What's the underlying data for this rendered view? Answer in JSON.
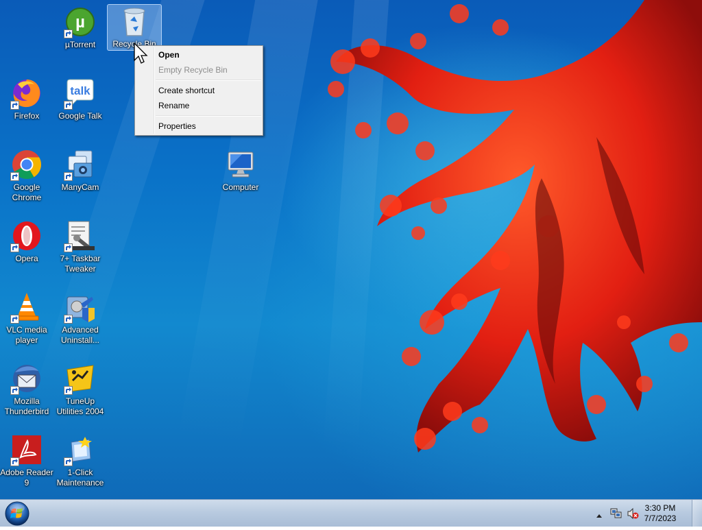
{
  "desktop_icons": [
    {
      "label": "µTorrent",
      "icon": "utorrent-icon"
    },
    {
      "label": "Recycle Bin",
      "icon": "recycle-bin-icon"
    },
    {
      "label": "Firefox",
      "icon": "firefox-icon"
    },
    {
      "label": "Google Talk",
      "icon": "google-talk-icon"
    },
    {
      "label": "Google\nChrome",
      "icon": "chrome-icon"
    },
    {
      "label": "ManyCam",
      "icon": "manycam-icon"
    },
    {
      "label": "Computer",
      "icon": "computer-icon"
    },
    {
      "label": "Opera",
      "icon": "opera-icon"
    },
    {
      "label": "7+ Taskbar\nTweaker",
      "icon": "taskbar-tweaker-icon"
    },
    {
      "label": "VLC media\nplayer",
      "icon": "vlc-icon"
    },
    {
      "label": "Advanced\nUninstall...",
      "icon": "advanced-uninstaller-icon"
    },
    {
      "label": "Mozilla\nThunderbird",
      "icon": "thunderbird-icon"
    },
    {
      "label": "TuneUp\nUtilities 2004",
      "icon": "tuneup-icon"
    },
    {
      "label": "Adobe Reader\n9",
      "icon": "adobe-reader-icon"
    },
    {
      "label": "1-Click\nMaintenance",
      "icon": "maintenance-icon"
    }
  ],
  "context_menu": {
    "items": [
      {
        "label": "Open",
        "bold": true,
        "enabled": true
      },
      {
        "label": "Empty Recycle Bin",
        "enabled": false
      },
      {
        "label": "Create shortcut",
        "enabled": true
      },
      {
        "label": "Rename",
        "enabled": true
      },
      {
        "label": "Properties",
        "enabled": true
      }
    ]
  },
  "taskbar": {
    "start_icon": "windows-logo-icon",
    "tray_icons": [
      "show-hidden-icons-chevron",
      "network-icon",
      "volume-muted-icon"
    ],
    "time": "3:30 PM",
    "date": "7/7/2023"
  },
  "colors": {
    "taskbar": "#b7c9df",
    "menu_background": "#f0f0f0",
    "selection": "#aacdf5"
  }
}
